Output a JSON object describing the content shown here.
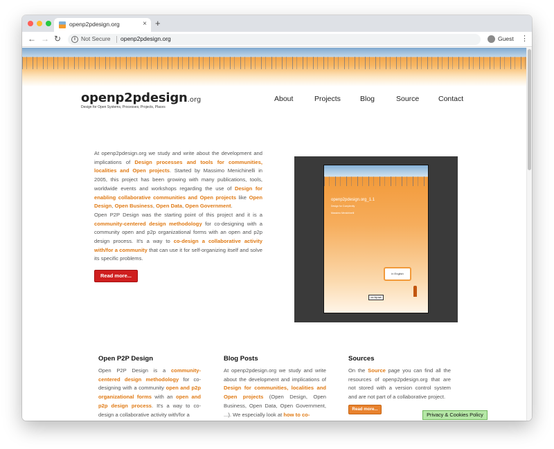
{
  "browser": {
    "tab_title": "openp2pdesign.org",
    "tab_close": "×",
    "new_tab": "+",
    "back": "←",
    "forward": "→",
    "reload": "↻",
    "info": "i",
    "security_label": "Not Secure",
    "url": "openp2pdesign.org",
    "profile_label": "Guest",
    "menu": "⋮"
  },
  "site": {
    "logo_main": "openp2pdesign",
    "logo_tld": ".org",
    "tagline": "Design for Open Systems, Processes, Projects, Places",
    "nav": [
      "About",
      "Projects",
      "Blog",
      "Source",
      "Contact"
    ]
  },
  "intro": {
    "t1": "At openp2pdesign.org we study and write about the development and implications of ",
    "l1": "Design processes and tools for communities, localities and Open projects",
    "t2": ". Started by Massimo Menichinelli in 2005, this project has been growing with many publications, tools, worldwide events and workshops regarding the use of ",
    "l2": "Design for enabling collaborative communities and Open projects",
    "t3": " like ",
    "l3": "Open Design",
    "t4": ", ",
    "l4": "Open Business",
    "t5": ", ",
    "l5": "Open Data",
    "t6": ", ",
    "l6": "Open Government",
    "t7": ".",
    "t8": "Open P2P Design was the starting point of this project and it is a ",
    "l7": "community-centered design methodology",
    "t9": " for co-designing with a community open and p2p organizational forms with an open and p2p design process. It's a way to ",
    "l8": "co-design a collaborative activity with/for a community",
    "t10": " that can use it for self-organizing itself and solve its specific problems.",
    "read_more": "Read more..."
  },
  "book": {
    "title": "openp2pdesign.org_1.1",
    "subtitle": "Design for Complexity",
    "author": "Massimo Menichinelli",
    "bubble": "in English",
    "license": "cc by-sa"
  },
  "columns": {
    "c1": {
      "title": "Open P2P Design",
      "t1": "Open P2P Design is a ",
      "l1": "community-centered design methodology",
      "t2": " for co-designing with a community ",
      "l2": "open and p2p organizational forms",
      "t3": " with an ",
      "l3": "open and p2p design process",
      "t4": ". It's a way to co-design a collaborative activity with/for a"
    },
    "c2": {
      "title": "Blog Posts",
      "t1": "At openp2pdesign.org we study and write about the development and implications of ",
      "l1": "Design for communities, localities and Open projects",
      "t2": " (Open Design, Open Business, Open Data, Open Government, ...). We especially look at ",
      "l2": "how to co-"
    },
    "c3": {
      "title": "Sources",
      "t1": "On the ",
      "l1": "Source",
      "t2": " page you can find all the resources of openp2pdesign.org that are not stored with a version control system and are not part of a collaborative project.",
      "button": "Read more..."
    }
  },
  "cookie_button": "Privacy & Cookies Policy"
}
